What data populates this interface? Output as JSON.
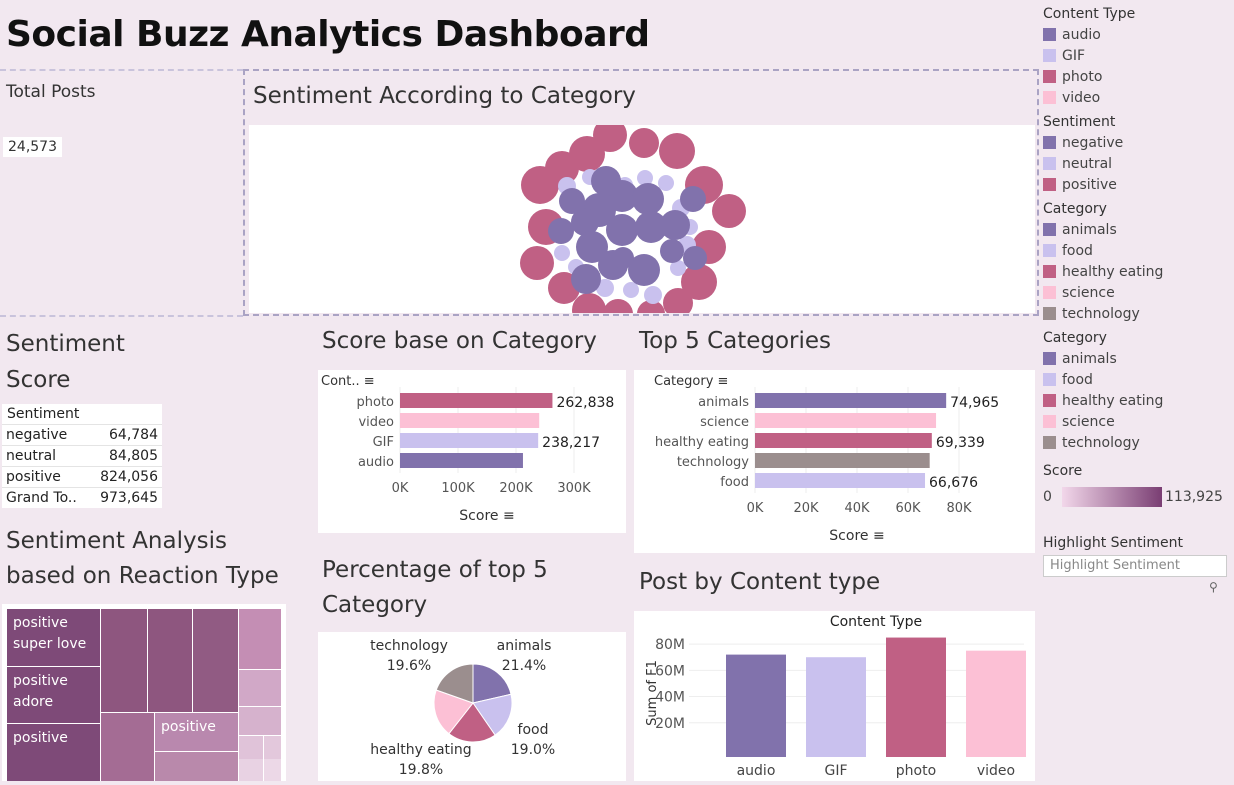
{
  "dashboard": {
    "title": "Social Buzz Analytics Dashboard",
    "total_posts_label": "Total Posts",
    "total_posts_value": "24,573",
    "bubble_title": "Sentiment According to Category",
    "sentiment_score_title": "Sentiment Score",
    "score_category_title": "Score base on Category",
    "top5_title": "Top 5  Categories",
    "reaction_title": "Sentiment Analysis based on Reaction Type",
    "pct_title": "Percentage of top 5 Category",
    "post_type_title": "Post by Content type",
    "highlight_label": "Highlight Sentiment",
    "highlight_placeholder": "Highlight Sentiment"
  },
  "sentiment_table": {
    "header": "Sentiment",
    "rows": [
      {
        "label": "negative",
        "value": "64,784"
      },
      {
        "label": "neutral",
        "value": "84,805"
      },
      {
        "label": "positive",
        "value": "824,056"
      },
      {
        "label": "Grand To..",
        "value": "973,645"
      }
    ]
  },
  "legends": {
    "content_type": {
      "title": "Content Type",
      "items": [
        {
          "label": "audio",
          "color": "#8172ac"
        },
        {
          "label": "GIF",
          "color": "#c9c1ee"
        },
        {
          "label": "photo",
          "color": "#c06084"
        },
        {
          "label": "video",
          "color": "#fcc0d5"
        }
      ]
    },
    "sentiment": {
      "title": "Sentiment",
      "items": [
        {
          "label": "negative",
          "color": "#8172ac"
        },
        {
          "label": "neutral",
          "color": "#c9c1ee"
        },
        {
          "label": "positive",
          "color": "#c06084"
        }
      ]
    },
    "category1": {
      "title": "Category",
      "items": [
        {
          "label": "animals",
          "color": "#8172ac"
        },
        {
          "label": "food",
          "color": "#c9c1ee"
        },
        {
          "label": "healthy eating",
          "color": "#c06084"
        },
        {
          "label": "science",
          "color": "#fcc0d5"
        },
        {
          "label": "technology",
          "color": "#9b8e8e"
        }
      ]
    },
    "category2": {
      "title": "Category",
      "items": [
        {
          "label": "animals",
          "color": "#8172ac"
        },
        {
          "label": "food",
          "color": "#c9c1ee"
        },
        {
          "label": "healthy eating",
          "color": "#c06084"
        },
        {
          "label": "science",
          "color": "#fcc0d5"
        },
        {
          "label": "technology",
          "color": "#9b8e8e"
        }
      ]
    },
    "score": {
      "title": "Score",
      "min": "0",
      "max": "113,925"
    }
  },
  "chart_data": [
    {
      "type": "bar",
      "id": "score_by_content",
      "orientation": "horizontal",
      "dimension_header": "Cont..",
      "xlabel": "Score",
      "xlim": [
        0,
        300000
      ],
      "ticks": [
        "0K",
        "100K",
        "200K",
        "300K"
      ],
      "categories": [
        "photo",
        "video",
        "GIF",
        "audio"
      ],
      "values": [
        262838,
        240000,
        238217,
        212000
      ],
      "labels": [
        "262,838",
        "",
        "238,217",
        ""
      ],
      "colors": [
        "#c06084",
        "#fcc0d5",
        "#c9c1ee",
        "#8172ac"
      ]
    },
    {
      "type": "bar",
      "id": "top5_categories",
      "orientation": "horizontal",
      "dimension_header": "Category",
      "xlabel": "Score",
      "xlim": [
        0,
        80000
      ],
      "ticks": [
        "0K",
        "20K",
        "40K",
        "60K",
        "80K"
      ],
      "categories": [
        "animals",
        "science",
        "healthy eating",
        "technology",
        "food"
      ],
      "values": [
        74965,
        71000,
        69339,
        68500,
        66676
      ],
      "labels": [
        "74,965",
        "",
        "69,339",
        "",
        "66,676"
      ],
      "colors": [
        "#8172ac",
        "#fcc0d5",
        "#c06084",
        "#9b8e8e",
        "#c9c1ee"
      ]
    },
    {
      "type": "pie",
      "id": "pct_top5",
      "slices": [
        {
          "label": "animals",
          "value": 21.4,
          "text": "21.4%",
          "color": "#8172ac"
        },
        {
          "label": "food",
          "value": 19.0,
          "text": "19.0%",
          "color": "#c9c1ee"
        },
        {
          "label": "",
          "value": 20.2,
          "text": "",
          "color": "#c06084"
        },
        {
          "label": "healthy eating",
          "value": 19.8,
          "text": "19.8%",
          "color": "#fcc0d5"
        },
        {
          "label": "technology",
          "value": 19.6,
          "text": "19.6%",
          "color": "#9b8e8e"
        }
      ]
    },
    {
      "type": "bar",
      "id": "post_by_content",
      "title": "Content Type",
      "ylabel": "Sum of F1",
      "ylim": [
        0,
        90
      ],
      "yticks": [
        "20M",
        "40M",
        "60M",
        "80M"
      ],
      "yticks_values": [
        20,
        40,
        60,
        80
      ],
      "categories": [
        "audio",
        "GIF",
        "photo",
        "video"
      ],
      "values": [
        72,
        70,
        85,
        75
      ],
      "colors": [
        "#8172ac",
        "#c9c1ee",
        "#c06084",
        "#fcc0d5"
      ]
    },
    {
      "type": "heatmap",
      "id": "reaction_treemap",
      "tiles": [
        {
          "text": "positive\nsuper love",
          "color": "#7e4a78"
        },
        {
          "text": "positive\nadore",
          "color": "#7e4a78"
        },
        {
          "text": "positive",
          "color": "#7e4a78"
        },
        {
          "text": "",
          "color": "#8e567f"
        },
        {
          "text": "",
          "color": "#8e567f"
        },
        {
          "text": "",
          "color": "#915b83"
        },
        {
          "text": "",
          "color": "#a46c94"
        },
        {
          "text": "positive",
          "color": "#b988ae"
        },
        {
          "text": "",
          "color": "#b989ab"
        },
        {
          "text": "",
          "color": "#c48eb4"
        },
        {
          "text": "",
          "color": "#d1a8c7"
        },
        {
          "text": "",
          "color": "#d6b2cd"
        },
        {
          "text": "",
          "color": "#e0c3d9"
        },
        {
          "text": "",
          "color": "#e3c8dc"
        },
        {
          "text": "",
          "color": "#e8d2e3"
        },
        {
          "text": "",
          "color": "#ecd8e7"
        }
      ]
    }
  ]
}
